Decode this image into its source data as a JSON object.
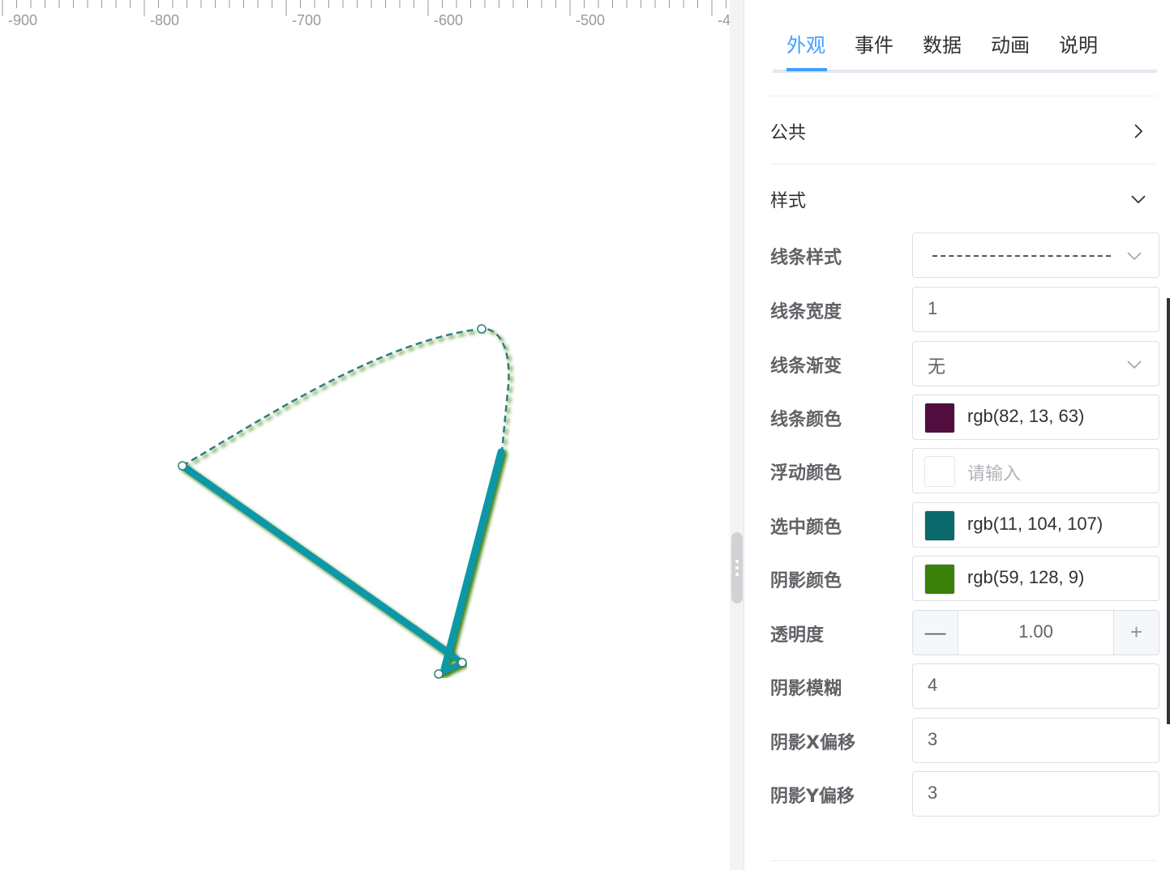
{
  "ruler": {
    "labels": [
      "-900",
      "-800",
      "-700",
      "-600",
      "-500",
      "-4"
    ]
  },
  "tabs": [
    {
      "label": "外观",
      "active": true
    },
    {
      "label": "事件",
      "active": false
    },
    {
      "label": "数据",
      "active": false
    },
    {
      "label": "动画",
      "active": false
    },
    {
      "label": "说明",
      "active": false
    }
  ],
  "sections": {
    "common": {
      "title": "公共",
      "expanded": false
    },
    "style": {
      "title": "样式",
      "expanded": true
    }
  },
  "properties": {
    "line_style": {
      "label": "线条样式",
      "value": "dashed"
    },
    "line_width": {
      "label": "线条宽度",
      "value": "1"
    },
    "line_gradient": {
      "label": "线条渐变",
      "value": "无"
    },
    "line_color": {
      "label": "线条颜色",
      "value": "rgb(82, 13, 63)",
      "color": "#520d3f"
    },
    "hover_color": {
      "label": "浮动颜色",
      "placeholder": "请输入",
      "color": "#ffffff"
    },
    "selected_color": {
      "label": "选中颜色",
      "value": "rgb(11, 104, 107)",
      "color": "#0b686b"
    },
    "shadow_color": {
      "label": "阴影颜色",
      "value": "rgb(59, 128, 9)",
      "color": "#3b8009"
    },
    "opacity": {
      "label": "透明度",
      "value": "1.00",
      "minus": "—",
      "plus": "+"
    },
    "shadow_blur": {
      "label": "阴影模糊",
      "value": "4"
    },
    "shadow_x": {
      "label": "阴影X偏移",
      "value": "3"
    },
    "shadow_y": {
      "label": "阴影Y偏移",
      "value": "3"
    }
  },
  "colors": {
    "accent": "#409eff",
    "line_stroke": "#1198a8",
    "dashed_stroke": "#2f7d80",
    "shadow": "#3b8009"
  },
  "icons": {
    "collapsed": "chevron-right-icon",
    "expanded": "chevron-down-icon",
    "select": "chevron-down-icon",
    "splitter": "drag-handle-icon"
  }
}
